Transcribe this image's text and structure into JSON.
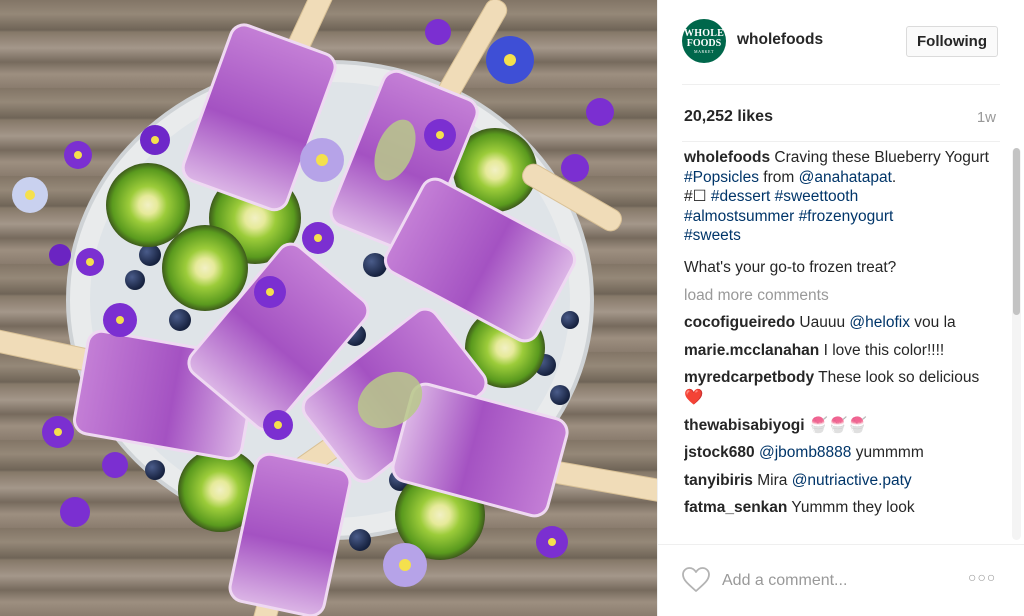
{
  "post": {
    "image_alt": "Blueberry yogurt popsicles with kiwi, blueberries and violets on a plate",
    "icon": "photo"
  },
  "header": {
    "avatar_text_line1": "WHOLE",
    "avatar_text_line2": "FOODS",
    "avatar_text_line3": "MARKET",
    "username": "wholefoods",
    "follow_label": "Following"
  },
  "stats": {
    "likes": "20,252 likes",
    "time": "1w"
  },
  "caption": {
    "user": "wholefoods",
    "text1": "Craving these Blueberry Yogurt",
    "tag1": "#Popsicles",
    "text2": "from",
    "mention": "@anahatapat",
    "text3": ".",
    "line2_prefix": "#☐",
    "tag2": "#dessert",
    "tag3": "#sweettooth",
    "tag4": "#almostsummer",
    "tag5": "#frozenyogurt",
    "tag6": "#sweets",
    "question": "What's your go-to frozen treat?"
  },
  "load_more": "load more comments",
  "comments": [
    {
      "user": "cocofigueiredo",
      "pre": "Uauuu",
      "mention": "@helofix",
      "post": "vou la"
    },
    {
      "user": "marie.mcclanahan",
      "pre": "I love this color!!!!",
      "mention": "",
      "post": ""
    },
    {
      "user": "myredcarpetbody",
      "pre": "These look so delicious ❤️",
      "mention": "",
      "post": ""
    },
    {
      "user": "thewabisabiyogi",
      "pre": "🍧🍧🍧",
      "mention": "",
      "post": ""
    },
    {
      "user": "jstock680",
      "pre": "",
      "mention": "@jbomb8888",
      "post": "yummmm"
    },
    {
      "user": "tanyibiris",
      "pre": "Mira",
      "mention": "@nutriactive.paty",
      "post": ""
    },
    {
      "user": "fatma_senkan",
      "pre": "Yummm they look",
      "mention": "",
      "post": ""
    }
  ],
  "footer": {
    "heart_icon": "heart-outline-icon",
    "add_comment_placeholder": "Add a comment...",
    "more_label": "○○○"
  },
  "colors": {
    "link": "#003569",
    "avatar_bg": "#00674b",
    "muted": "#999999",
    "border": "#efefef"
  }
}
